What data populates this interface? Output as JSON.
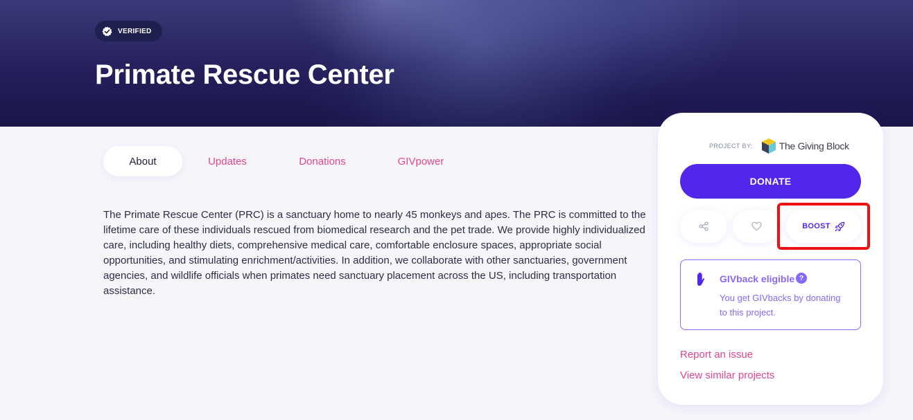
{
  "hero": {
    "verified_label": "VERIFIED",
    "title": "Primate Rescue Center"
  },
  "tabs": [
    {
      "label": "About",
      "active": true
    },
    {
      "label": "Updates",
      "active": false
    },
    {
      "label": "Donations",
      "active": false
    },
    {
      "label": "GIVpower",
      "active": false
    }
  ],
  "description": "The Primate Rescue Center (PRC) is a sanctuary home to nearly 45 monkeys and apes. The PRC is committed to the lifetime care of these individuals rescued from biomedical research and the pet trade. We provide highly individualized care, including healthy diets, comprehensive medical care, comfortable enclosure spaces, appropriate social opportunities, and stimulating enrichment/activities. In addition, we collaborate with other sanctuaries, government agencies, and wildlife officials when primates need sanctuary placement across the US, including transportation assistance.",
  "side_card": {
    "project_by_label": "PROJECT BY:",
    "organization_name": "The Giving Block",
    "donate_label": "DONATE",
    "share_icon": "share-icon",
    "like_icon": "heart-icon",
    "boost_label": "BOOST",
    "boost_icon": "rocket-icon",
    "givback": {
      "title": "GIVback eligible",
      "help_glyph": "?",
      "text": "You get GIVbacks by donating to this project."
    },
    "report_link": "Report an issue",
    "similar_link": "View similar projects"
  },
  "colors": {
    "primary": "#5326ec",
    "link_pink": "#e1458d",
    "givback_purple": "#8668fc",
    "highlight_red": "#ee1111"
  }
}
